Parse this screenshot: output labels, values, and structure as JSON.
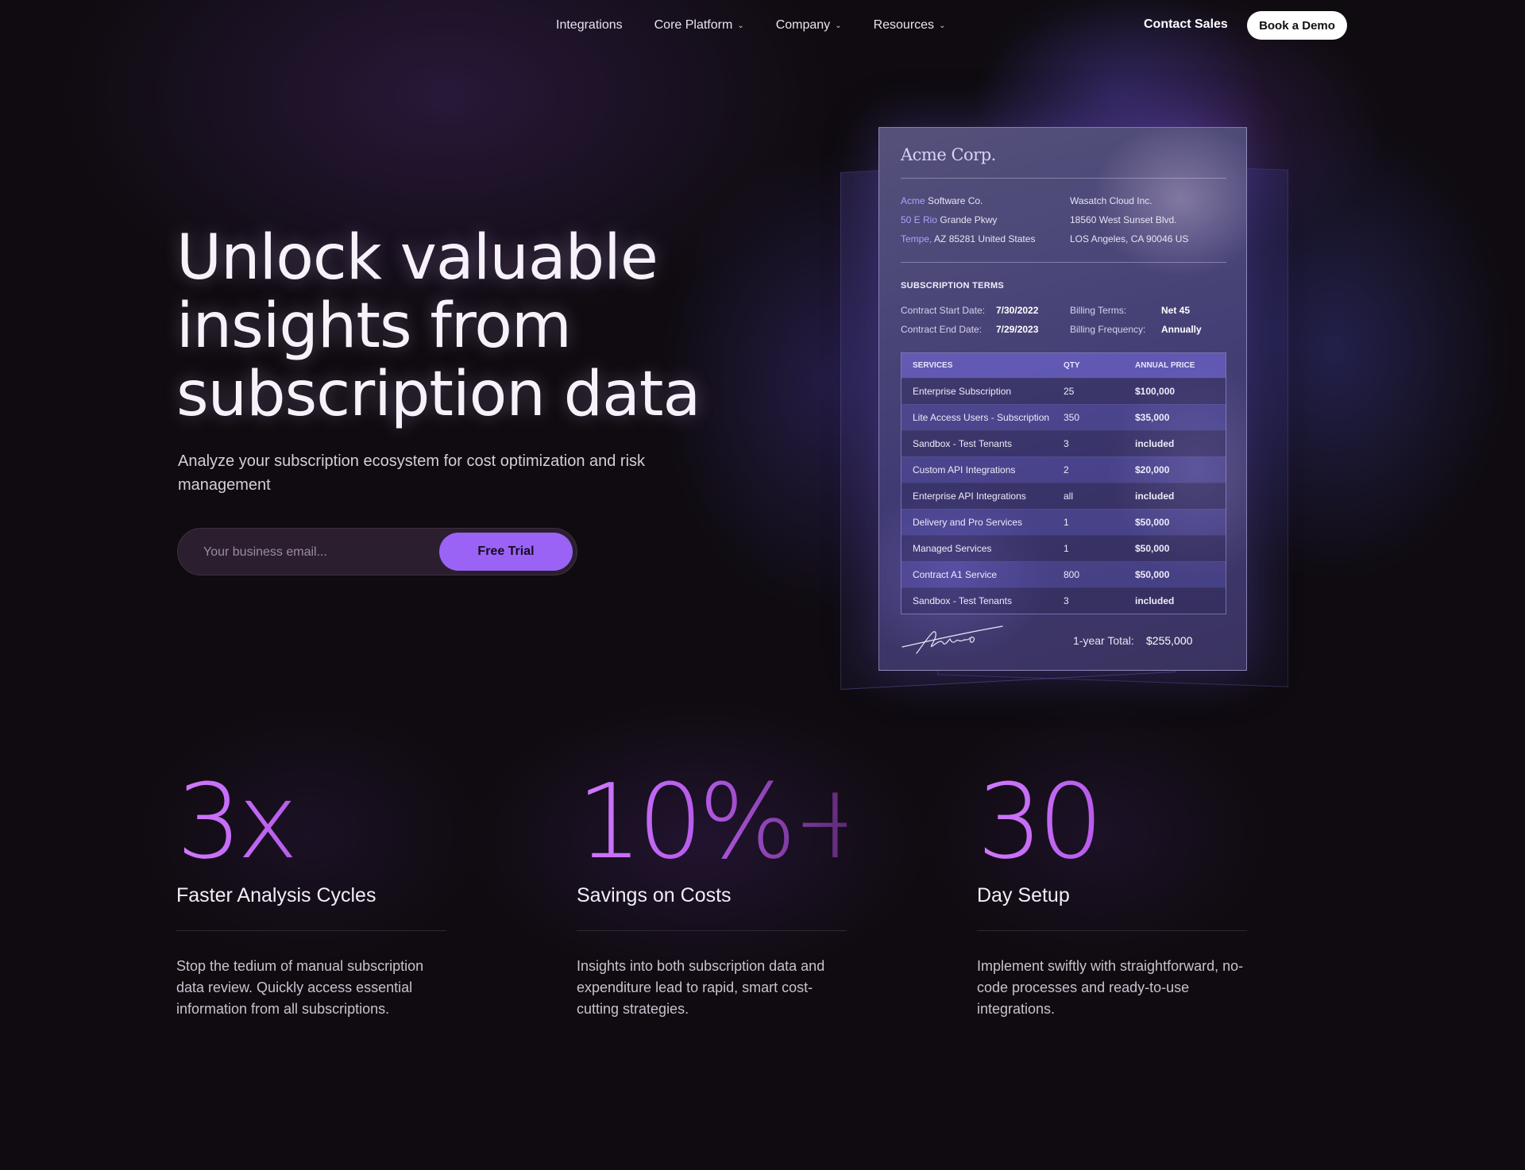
{
  "nav": {
    "items": [
      {
        "label": "Integrations",
        "has_dropdown": false
      },
      {
        "label": "Core Platform",
        "has_dropdown": true
      },
      {
        "label": "Company",
        "has_dropdown": true
      },
      {
        "label": "Resources",
        "has_dropdown": true
      }
    ],
    "contact_label": "Contact Sales",
    "demo_label": "Book a Demo"
  },
  "hero": {
    "title_lines": [
      "Unlock valuable",
      "insights from",
      "subscription data"
    ],
    "subtitle": "Analyze your subscription ecosystem for cost optimization and risk management",
    "email_placeholder": "Your business email...",
    "cta_label": "Free Trial"
  },
  "invoice": {
    "logo": "Acme Corp.",
    "from": {
      "name_highlight": "Acme",
      "name_rest": " Software Co.",
      "street_highlight": "50 E Rio",
      "street_rest": " Grande Pkwy",
      "city_highlight": "Tempe,",
      "city_rest": " AZ 85281 United States"
    },
    "to": {
      "name": "Wasatch Cloud Inc.",
      "street": "18560 West Sunset Blvd.",
      "city": "LOS Angeles, CA 90046 US"
    },
    "terms_heading": "SUBSCRIPTION TERMS",
    "terms": {
      "start_label": "Contract Start Date:",
      "start_value": "7/30/2022",
      "end_label": "Contract End Date:",
      "end_value": "7/29/2023",
      "billing_label": "Billing Terms:",
      "billing_value": "Net 45",
      "frequency_label": "Billing Frequency:",
      "frequency_value": "Annually"
    },
    "table": {
      "headers": [
        "SERVICES",
        "QTY",
        "ANNUAL PRICE"
      ],
      "rows": [
        [
          "Enterprise Subscription",
          "25",
          "$100,000"
        ],
        [
          "Lite Access Users - Subscription",
          "350",
          "$35,000"
        ],
        [
          "Sandbox - Test Tenants",
          "3",
          "included"
        ],
        [
          "Custom API Integrations",
          "2",
          "$20,000"
        ],
        [
          "Enterprise API Integrations",
          "all",
          "included"
        ],
        [
          "Delivery and Pro Services",
          "1",
          "$50,000"
        ],
        [
          "Managed Services",
          "1",
          "$50,000"
        ],
        [
          "Contract A1 Service",
          "800",
          "$50,000"
        ],
        [
          "Sandbox - Test Tenants",
          "3",
          "included"
        ]
      ]
    },
    "total_label": "1-year Total:",
    "total_value": "$255,000"
  },
  "stats": [
    {
      "number": "3x",
      "title": "Faster Analysis Cycles",
      "description": "Stop the tedium of manual subscription data review. Quickly access essential information from all subscriptions."
    },
    {
      "number": "10%+",
      "title": "Savings on Costs",
      "description": "Insights into both subscription data and expenditure lead to rapid, smart cost-cutting strategies."
    },
    {
      "number": "30",
      "title": "Day Setup",
      "description": "Implement swiftly with straightforward, no-code processes and ready-to-use integrations."
    }
  ],
  "colors": {
    "background": "#0f0b10",
    "accent": "#9a63f5",
    "stat_gradient_start": "#d27aff",
    "stat_gradient_end": "#5f2a76"
  }
}
